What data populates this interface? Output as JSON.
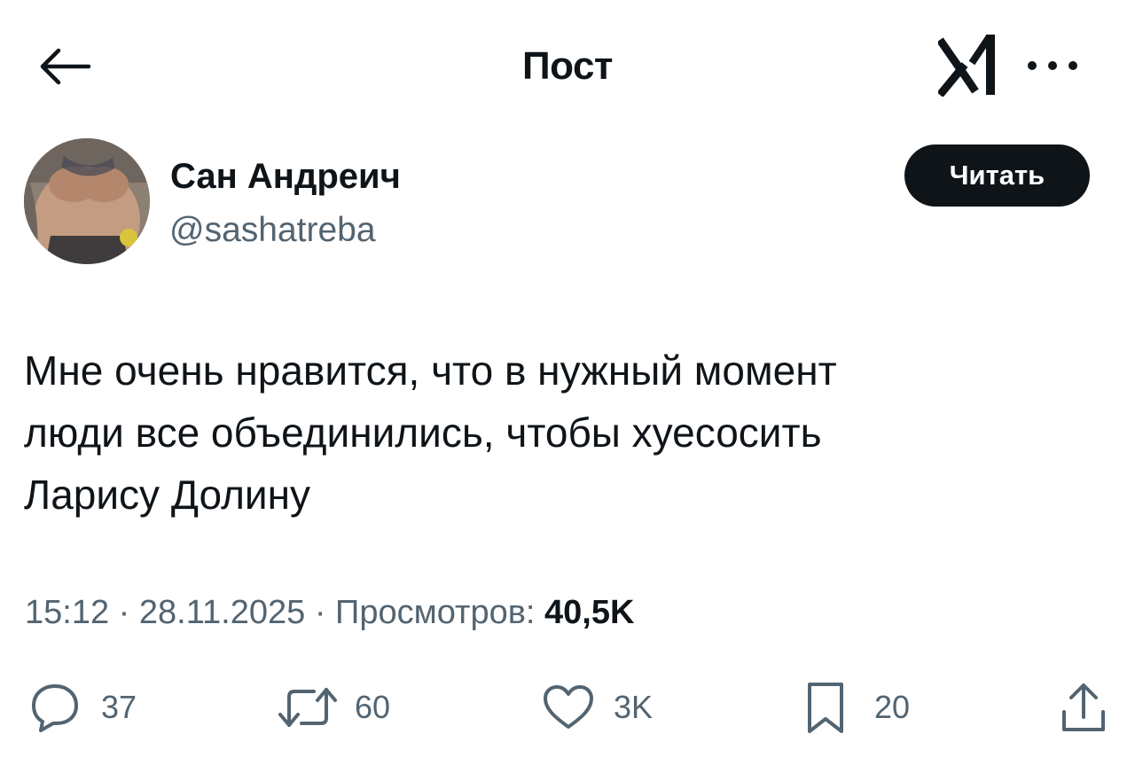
{
  "header": {
    "title": "Пост",
    "back_icon": "arrow-left-icon",
    "logo_icon": "x-logo-icon",
    "more_icon": "more-dots-icon"
  },
  "author": {
    "display_name": "Сан Андреич",
    "handle": "@sashatreba",
    "avatar": "avatar-photo",
    "follow_label": "Читать"
  },
  "post": {
    "text_lines": [
      "Мне очень нравится, что в нужный момент",
      "люди все объединились, чтобы хуесосить",
      "Ларису Долину"
    ],
    "time": "15:12",
    "date": "28.11.2025",
    "views_label": "Просмотров:",
    "views_count": "40,5K"
  },
  "actions": {
    "replies": {
      "icon": "reply-icon",
      "count": "37"
    },
    "reposts": {
      "icon": "repost-icon",
      "count": "60"
    },
    "likes": {
      "icon": "heart-icon",
      "count": "3K"
    },
    "bookmarks": {
      "icon": "bookmark-icon",
      "count": "20"
    },
    "share": {
      "icon": "share-icon"
    }
  },
  "colors": {
    "text_primary": "#0f1419",
    "text_secondary": "#536471",
    "button_bg": "#0f1419",
    "button_text": "#ffffff",
    "background": "#ffffff"
  }
}
